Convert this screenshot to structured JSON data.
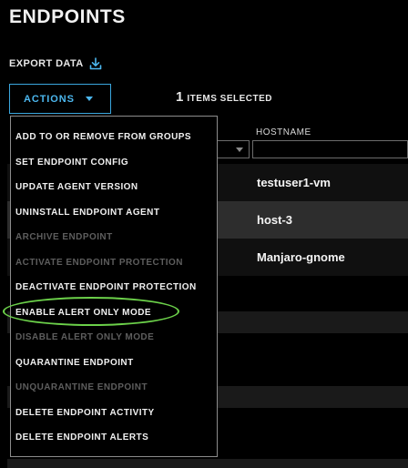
{
  "page": {
    "title": "ENDPOINTS",
    "export_label": "EXPORT DATA",
    "actions_label": "ACTIONS",
    "selected_count": "1",
    "selected_text": "ITEMS SELECTED"
  },
  "table": {
    "hostname_header": "HOSTNAME",
    "rows": [
      {
        "hostname": "testuser1-vm"
      },
      {
        "hostname": "host-3"
      },
      {
        "hostname": "Manjaro-gnome"
      }
    ]
  },
  "menu": {
    "items": [
      {
        "label": "ADD TO OR REMOVE FROM GROUPS",
        "enabled": true
      },
      {
        "label": "SET ENDPOINT CONFIG",
        "enabled": true
      },
      {
        "label": "UPDATE AGENT VERSION",
        "enabled": true
      },
      {
        "label": "UNINSTALL ENDPOINT AGENT",
        "enabled": true
      },
      {
        "label": "ARCHIVE ENDPOINT",
        "enabled": false
      },
      {
        "label": "ACTIVATE ENDPOINT PROTECTION",
        "enabled": false
      },
      {
        "label": "DEACTIVATE ENDPOINT PROTECTION",
        "enabled": true
      },
      {
        "label": "ENABLE ALERT ONLY MODE",
        "enabled": true
      },
      {
        "label": "DISABLE ALERT ONLY MODE",
        "enabled": false
      },
      {
        "label": "QUARANTINE ENDPOINT",
        "enabled": true
      },
      {
        "label": "UNQUARANTINE ENDPOINT",
        "enabled": false
      },
      {
        "label": "DELETE ENDPOINT ACTIVITY",
        "enabled": true
      },
      {
        "label": "DELETE ENDPOINT ALERTS",
        "enabled": true
      }
    ]
  },
  "colors": {
    "accent": "#3aa6dd",
    "highlight_ring": "#6cd14a",
    "disabled_text": "#5d5d5d"
  },
  "icons": {
    "export": "download-icon",
    "actions_caret": "caret-down-icon",
    "filter_caret": "caret-down-icon"
  }
}
